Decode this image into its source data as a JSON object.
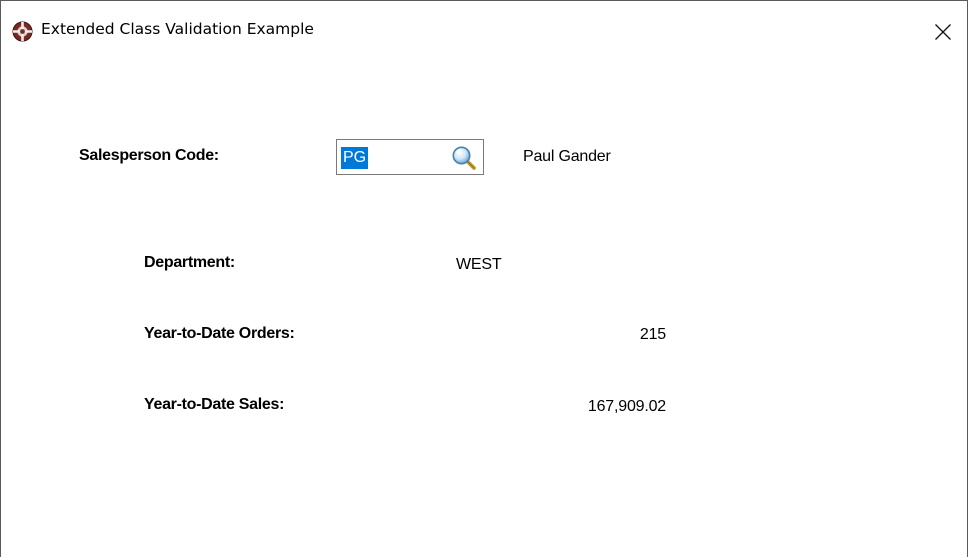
{
  "window": {
    "title": "Extended Class Validation Example",
    "app_icon": "app-logo-icon",
    "close_icon": "close-icon"
  },
  "form": {
    "salesperson_label": "Salesperson Code:",
    "salesperson_code": "PG",
    "lookup_icon": "magnifier-icon",
    "salesperson_name": "Paul Gander",
    "department_label": "Department:",
    "department_value": "WEST",
    "ytd_orders_label": "Year-to-Date Orders:",
    "ytd_orders_value": "215",
    "ytd_sales_label": "Year-to-Date Sales:",
    "ytd_sales_value": "167,909.02"
  },
  "colors": {
    "selection": "#0078d7",
    "border": "#7a7a7a"
  }
}
